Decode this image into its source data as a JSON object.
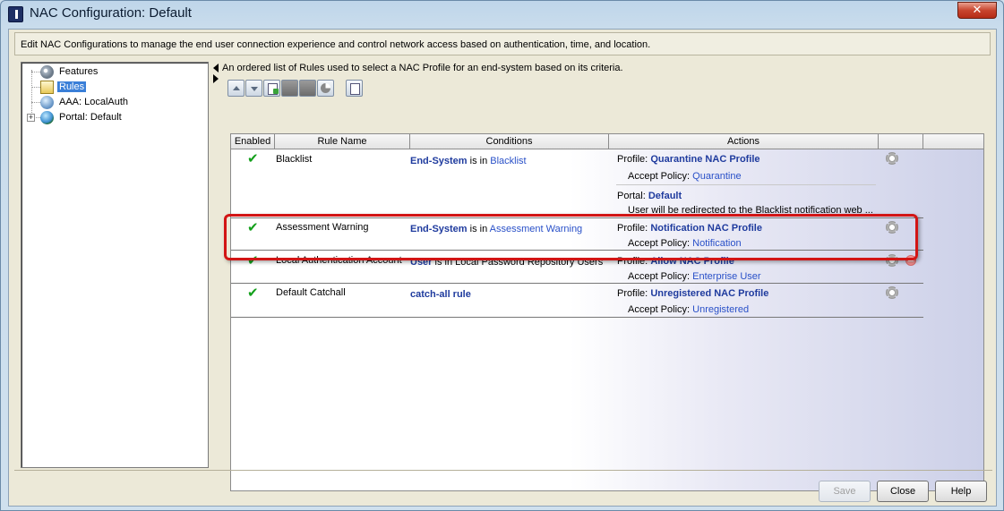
{
  "window": {
    "title": "NAC Configuration: Default",
    "close_label": "✕"
  },
  "description": "Edit NAC Configurations to manage the end user connection experience and control network access based on authentication, time, and location.",
  "tree": {
    "items": [
      {
        "label": "Features",
        "icon": "features-icon"
      },
      {
        "label": "Rules",
        "icon": "rules-icon",
        "selected": true
      },
      {
        "label": "AAA: LocalAuth",
        "icon": "aaa-icon"
      },
      {
        "label": "Portal: Default",
        "icon": "portal-globe-icon",
        "expander": "+"
      }
    ]
  },
  "rules": {
    "description": "An ordered list of Rules used to select a NAC Profile for an end-system based on its criteria.",
    "columns": [
      "Enabled",
      "Rule Name",
      "Conditions",
      "Actions",
      ""
    ],
    "rows": [
      {
        "enabled": "✔",
        "name": "Blacklist",
        "condition_subject": "End-System",
        "condition_op": " is in ",
        "condition_value": "Blacklist",
        "profile_label": "Profile:",
        "profile_value": "Quarantine NAC Profile",
        "policy_label": "Accept Policy:",
        "policy_value": "Quarantine",
        "portal_label": "Portal:",
        "portal_value": "Default",
        "portal_note": "User will be redirected to the Blacklist notification web ..."
      },
      {
        "enabled": "✔",
        "name": "Assessment Warning",
        "condition_subject": "End-System",
        "condition_op": " is in ",
        "condition_value": "Assessment Warning",
        "profile_label": "Profile:",
        "profile_value": "Notification NAC Profile",
        "policy_label": "Accept Policy:",
        "policy_value": "Notification"
      },
      {
        "enabled": "✔",
        "name": "Local Authentication Account",
        "condition_subject": "User",
        "condition_op": " is in Local Password Repository Users",
        "condition_value": "",
        "profile_label": "Profile:",
        "profile_value": "Allow NAC Profile",
        "policy_label": "Accept Policy:",
        "policy_value": "Enterprise User"
      },
      {
        "enabled": "✔",
        "name": "Default Catchall",
        "condition_subject": "catch-all rule",
        "condition_op": "",
        "condition_value": "",
        "profile_label": "Profile:",
        "profile_value": "Unregistered NAC Profile",
        "policy_label": "Accept Policy:",
        "policy_value": "Unregistered"
      }
    ]
  },
  "buttons": {
    "save": "Save",
    "close": "Close",
    "help": "Help"
  }
}
